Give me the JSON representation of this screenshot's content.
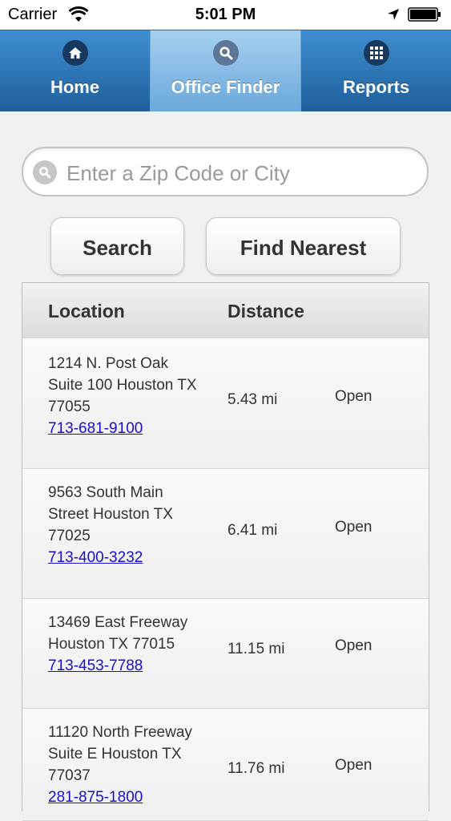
{
  "status_bar": {
    "carrier": "Carrier",
    "time": "5:01 PM"
  },
  "nav": {
    "tabs": [
      {
        "label": "Home",
        "icon": "home-icon",
        "active": false
      },
      {
        "label": "Office Finder",
        "icon": "search-icon",
        "active": true
      },
      {
        "label": "Reports",
        "icon": "grid-icon",
        "active": false
      }
    ]
  },
  "search": {
    "placeholder": "Enter a Zip Code or City",
    "value": ""
  },
  "buttons": {
    "search": "Search",
    "find_nearest": "Find Nearest"
  },
  "table": {
    "headers": {
      "location": "Location",
      "distance": "Distance"
    },
    "rows": [
      {
        "address": [
          "1214 N. Post Oak",
          "Suite 100 Houston TX",
          "77055"
        ],
        "phone": "713-681-9100",
        "distance": "5.43 mi",
        "status": "Open"
      },
      {
        "address": [
          "9563 South Main",
          "Street Houston TX",
          "77025"
        ],
        "phone": "713-400-3232",
        "distance": "6.41 mi",
        "status": "Open"
      },
      {
        "address": [
          "13469 East Freeway",
          "Houston TX 77015"
        ],
        "phone": "713-453-7788",
        "distance": "11.15 mi",
        "status": "Open"
      },
      {
        "address": [
          "11120 North Freeway",
          "Suite E Houston TX",
          "77037"
        ],
        "phone": "281-875-1800",
        "distance": "11.76 mi",
        "status": "Open"
      }
    ]
  },
  "colors": {
    "nav_top": "#3f8fd0",
    "nav_bottom": "#1f5f9c",
    "active_tab": "#8fc0e6",
    "link": "#1a0dcc"
  }
}
